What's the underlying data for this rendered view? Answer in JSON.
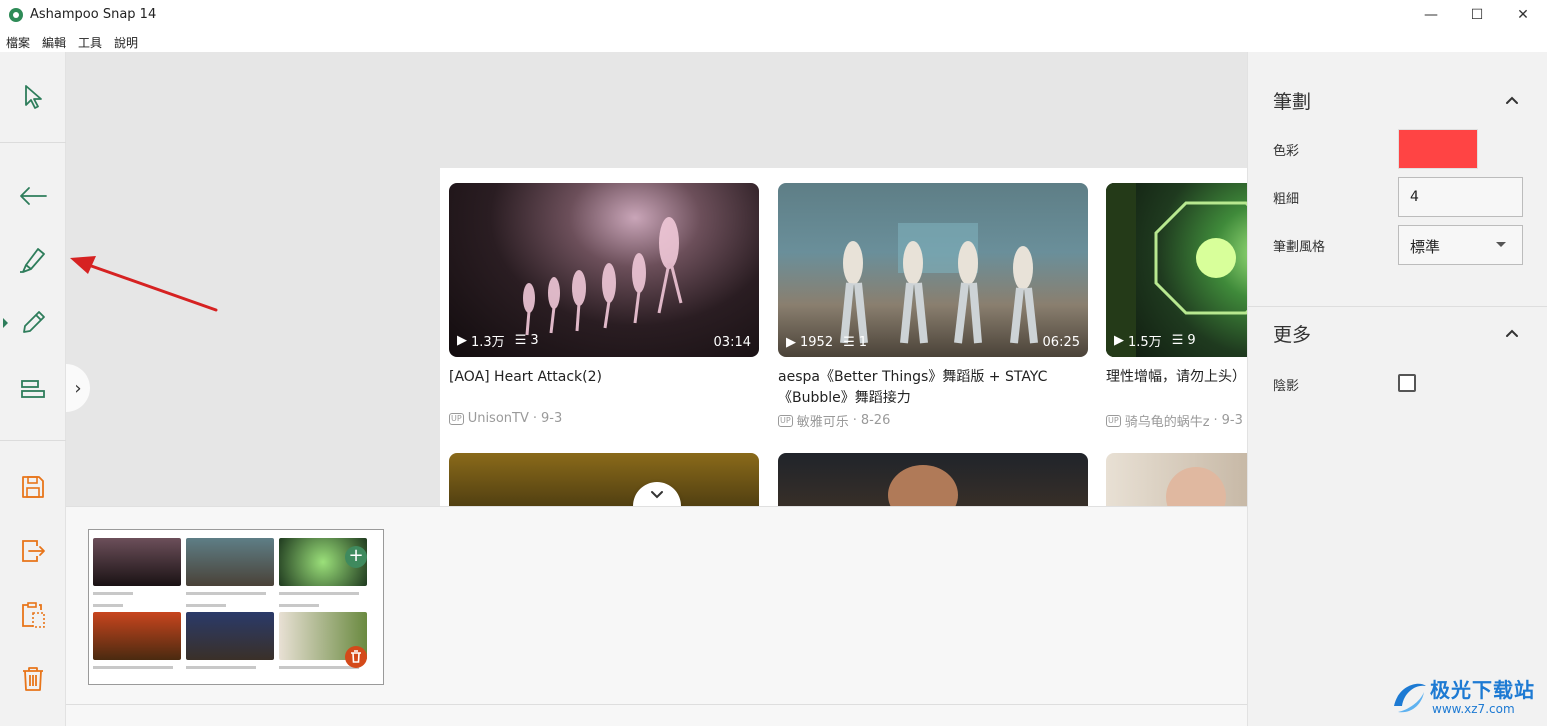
{
  "window": {
    "title": "Ashampoo Snap 14",
    "controls": {
      "minimize": "—",
      "maximize": "☐",
      "close": "✕"
    }
  },
  "menu": [
    "檔案",
    "編輯",
    "工具",
    "說明"
  ],
  "toolbar": {
    "tools": [
      "select-tool",
      "arrow-tool",
      "marker-tool",
      "pencil-tool",
      "align-tool"
    ],
    "actions": [
      "save",
      "export",
      "clipboard",
      "delete"
    ],
    "expand_icon": "›"
  },
  "screenshot": {
    "videos": [
      {
        "title": "[AOA] Heart Attack(2)",
        "views": "1.3万",
        "comments": "3",
        "duration": "03:14",
        "uploader": "UnisonTV",
        "date": "9-3"
      },
      {
        "title": "aespa《Better Things》舞蹈版 + STAYC《Bubble》舞蹈接力",
        "views": "1952",
        "comments": "1",
        "duration": "06:25",
        "uploader": "敏雅可乐",
        "date": "8-26"
      },
      {
        "title": "理性增幅，请勿上头）",
        "views": "1.5万",
        "comments": "9",
        "duration": "",
        "uploader": "骑乌龟的蜗牛z",
        "date": "9-3"
      }
    ],
    "up_badge": "UP",
    "date_separator": "·"
  },
  "right_panel": {
    "stroke_section": {
      "title": "筆劃",
      "color_label": "色彩",
      "color_value": "#ff4444",
      "thickness_label": "粗細",
      "thickness_value": "4",
      "style_label": "筆劃風格",
      "style_value": "標準"
    },
    "more_section": {
      "title": "更多",
      "shadow_label": "陰影",
      "shadow_checked": false
    }
  },
  "watermark": {
    "main": "极光下载站",
    "sub": "www.xz7.com"
  },
  "colors": {
    "accent_green": "#2e7d5b",
    "accent_orange": "#e8751a",
    "arrow_red": "#d62222"
  }
}
